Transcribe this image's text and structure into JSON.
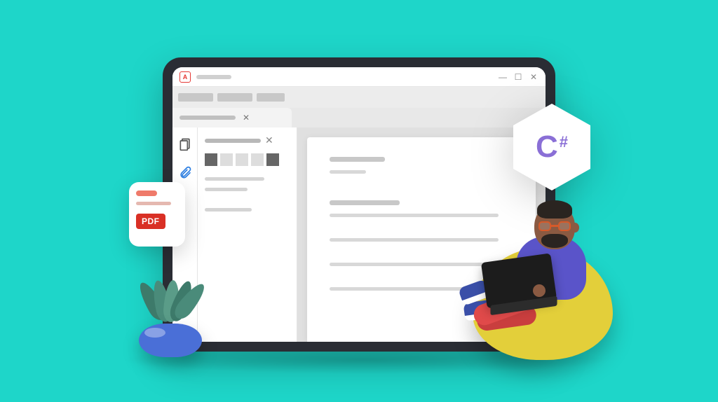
{
  "pdf_badge": {
    "label": "PDF"
  },
  "csharp_badge": {
    "letter": "C",
    "hash": "#"
  },
  "colors": {
    "background": "#1ed6c9",
    "pdf_red": "#d93025",
    "csharp_purple": "#8a6fd6",
    "beanbag": "#e3cf3a",
    "shirt": "#5a54c9",
    "pants": "#e04a4a"
  }
}
